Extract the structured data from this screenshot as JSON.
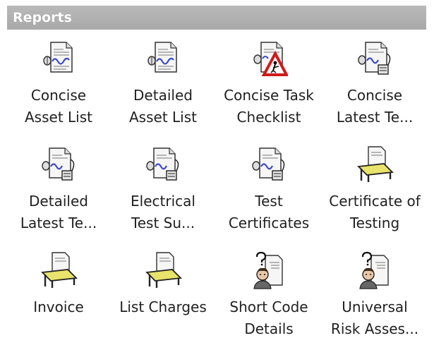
{
  "panel": {
    "title": "Reports"
  },
  "reports": [
    {
      "line1": "Concise",
      "line2": "Asset List",
      "icon": "report-doc-icon"
    },
    {
      "line1": "Detailed",
      "line2": "Asset List",
      "icon": "report-doc-icon"
    },
    {
      "line1": "Concise Task",
      "line2": "Checklist",
      "icon": "report-warning-icon"
    },
    {
      "line1": "Concise",
      "line2": "Latest Te...",
      "icon": "report-tester-icon"
    },
    {
      "line1": "Detailed",
      "line2": "Latest Te...",
      "icon": "report-tester-icon"
    },
    {
      "line1": "Electrical",
      "line2": "Test Su...",
      "icon": "report-tester-icon"
    },
    {
      "line1": "Test",
      "line2": "Certificates",
      "icon": "report-tester-icon"
    },
    {
      "line1": "Certificate of",
      "line2": "Testing",
      "icon": "certificate-icon"
    },
    {
      "line1": "Invoice",
      "line2": "",
      "icon": "invoice-icon"
    },
    {
      "line1": "List Charges",
      "line2": "",
      "icon": "invoice-icon"
    },
    {
      "line1": "Short Code",
      "line2": "Details",
      "icon": "person-doc-icon"
    },
    {
      "line1": "Universal",
      "line2": "Risk Asses...",
      "icon": "person-doc-icon"
    }
  ]
}
